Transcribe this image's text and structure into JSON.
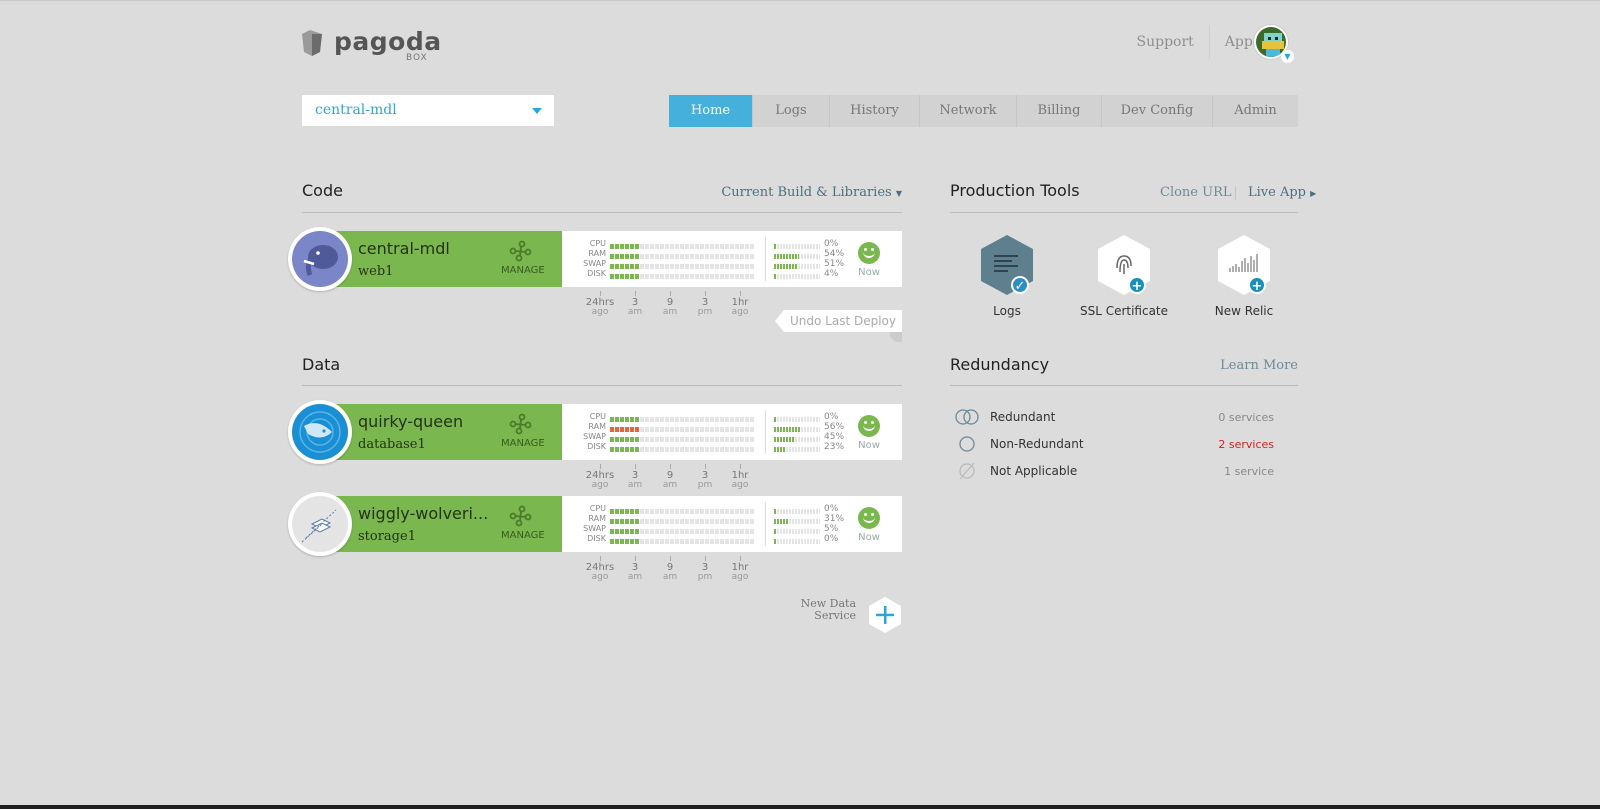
{
  "header": {
    "logo_text": "pagoda",
    "logo_sub": "BOX",
    "links": [
      "Support",
      "Apps"
    ],
    "app_select": "central-mdl"
  },
  "tabs": [
    "Home",
    "Logs",
    "History",
    "Network",
    "Billing",
    "Dev Config",
    "Admin"
  ],
  "active_tab": "Home",
  "code": {
    "title": "Code",
    "link": "Current Build & Libraries",
    "undo": "Undo Last Deploy"
  },
  "data": {
    "title": "Data",
    "new_service_line1": "New Data",
    "new_service_line2": "Service"
  },
  "metric_labels": [
    "CPU",
    "RAM",
    "SWAP",
    "DISK"
  ],
  "manage_label": "MANAGE",
  "now_label": "Now",
  "time_ticks": [
    {
      "top": "24hrs",
      "bottom": "ago"
    },
    {
      "top": "3",
      "bottom": "am"
    },
    {
      "top": "9",
      "bottom": "am"
    },
    {
      "top": "3",
      "bottom": "pm"
    },
    {
      "top": "1hr",
      "bottom": "ago"
    }
  ],
  "services": [
    {
      "name": "central-mdl",
      "sub": "web1",
      "pcts": [
        "0%",
        "54%",
        "51%",
        "4%"
      ],
      "fill": [
        0.05,
        0.54,
        0.51,
        0.04
      ],
      "ram_red": false,
      "icon": "elephant-icon"
    },
    {
      "name": "quirky-queen",
      "sub": "database1",
      "pcts": [
        "0%",
        "56%",
        "45%",
        "23%"
      ],
      "fill": [
        0.05,
        0.56,
        0.45,
        0.23
      ],
      "ram_red": true,
      "icon": "dolphin-icon"
    },
    {
      "name": "wiggly-wolveri...",
      "sub": "storage1",
      "pcts": [
        "0%",
        "31%",
        "5%",
        "0%"
      ],
      "fill": [
        0.0,
        0.31,
        0.05,
        0.0
      ],
      "ram_red": false,
      "icon": "storage-icon"
    }
  ],
  "production": {
    "title": "Production Tools",
    "link1": "Clone URL",
    "link2": "Live App",
    "tools": [
      {
        "label": "Logs",
        "icon": "logs-icon",
        "state": "enabled"
      },
      {
        "label": "SSL Certificate",
        "icon": "fingerprint-icon",
        "state": "add"
      },
      {
        "label": "New Relic",
        "icon": "new-relic-icon",
        "state": "add"
      }
    ]
  },
  "redundancy": {
    "title": "Redundancy",
    "link": "Learn More",
    "rows": [
      {
        "label": "Redundant",
        "count": "0 services",
        "alert": false
      },
      {
        "label": "Non-Redundant",
        "count": "2 services",
        "alert": true
      },
      {
        "label": "Not Applicable",
        "count": "1 service",
        "alert": false
      }
    ]
  },
  "colors": {
    "accent": "#45b0dc",
    "green": "#7ab84f",
    "alert": "#d62020",
    "background": "#dcdcdc"
  }
}
